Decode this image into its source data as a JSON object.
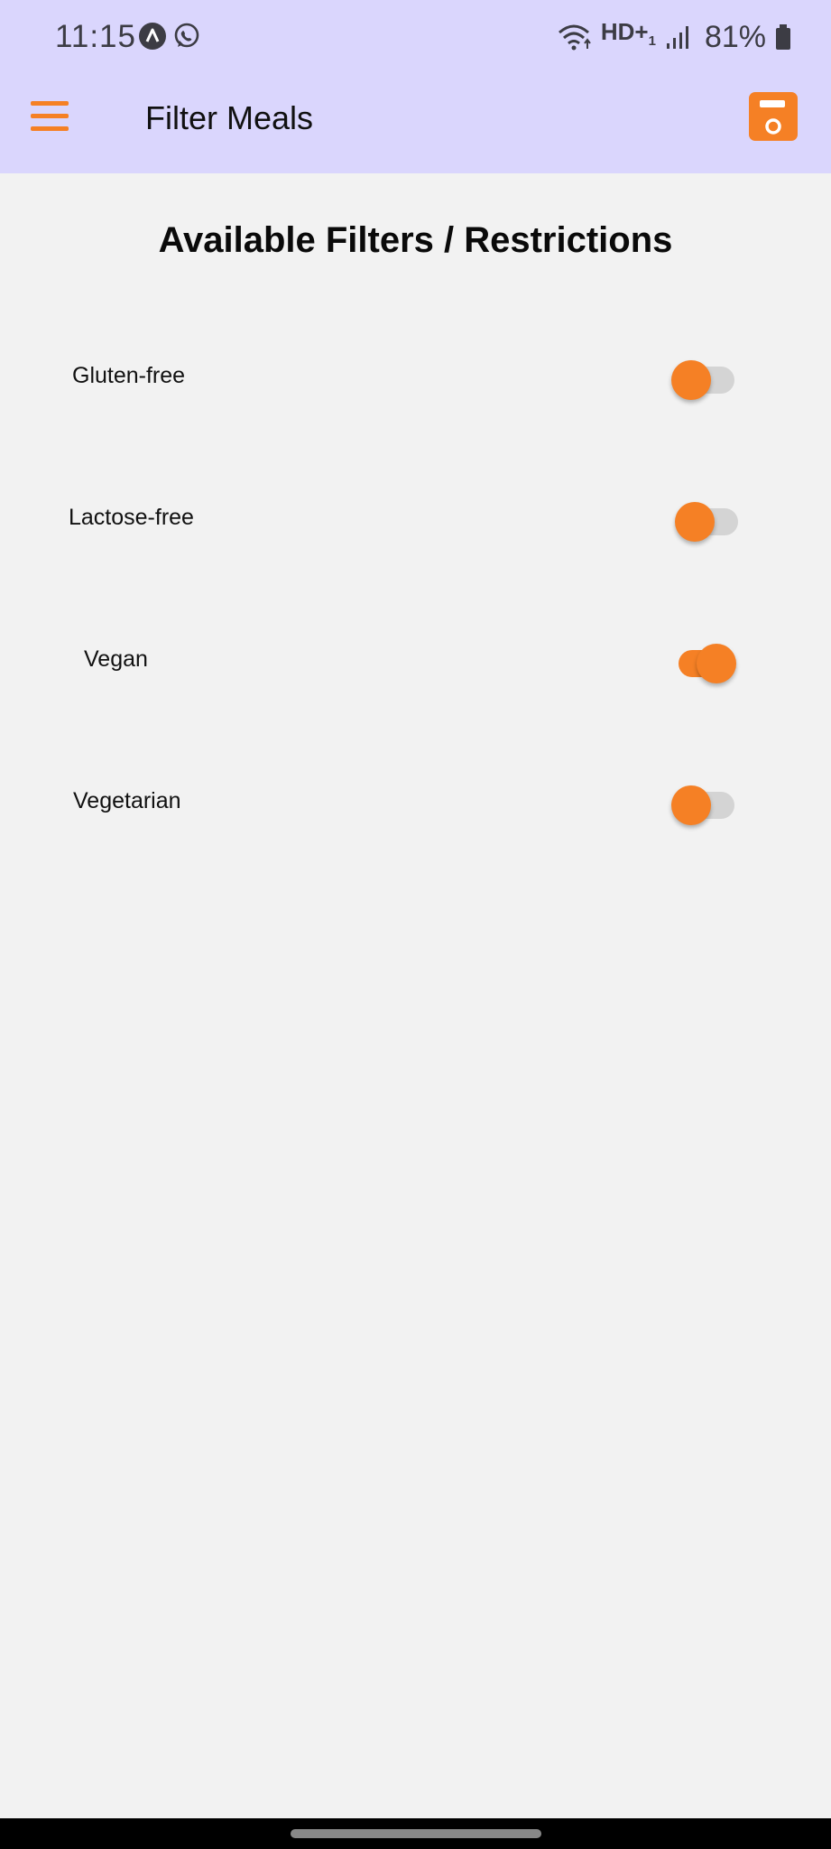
{
  "status_bar": {
    "time": "11:15",
    "battery_percent": "81%",
    "left_icons": [
      "app-a-icon",
      "whatsapp-icon"
    ],
    "right_icons": [
      "wifi-icon",
      "hd-voice-icon",
      "signal-icon",
      "battery-icon"
    ],
    "hd_label": "HD+",
    "hd_sub": "1"
  },
  "app_bar": {
    "title": "Filter Meals",
    "menu_icon": "hamburger-menu-icon",
    "save_icon": "save-icon",
    "background": "#dad6fd",
    "accent": "#f58025"
  },
  "main": {
    "title": "Available Filters / Restrictions",
    "filters": [
      {
        "label": "Gluten-free",
        "enabled": false
      },
      {
        "label": "Lactose-free",
        "enabled": false
      },
      {
        "label": "Vegan",
        "enabled": true
      },
      {
        "label": "Vegetarian",
        "enabled": false
      }
    ]
  }
}
